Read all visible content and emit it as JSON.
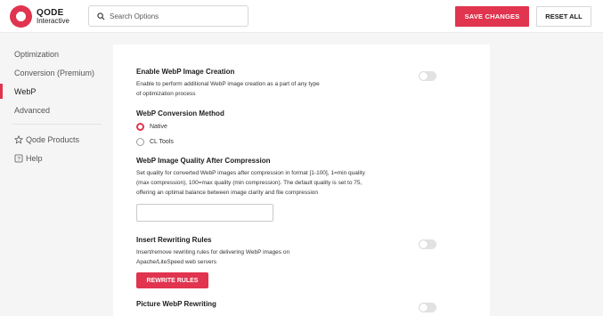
{
  "brand": {
    "name": "QODE",
    "sub": "Interactive"
  },
  "search": {
    "placeholder": "Search Options"
  },
  "header": {
    "save_label": "SAVE CHANGES",
    "reset_label": "RESET ALL"
  },
  "sidebar": {
    "items": [
      {
        "label": "Optimization",
        "active": false
      },
      {
        "label": "Conversion (Premium)",
        "active": false
      },
      {
        "label": "WebP",
        "active": true
      },
      {
        "label": "Advanced",
        "active": false
      }
    ],
    "aux": [
      {
        "label": "Qode Products",
        "icon": "star-icon"
      },
      {
        "label": "Help",
        "icon": "help-icon"
      }
    ]
  },
  "content": {
    "enable_webp": {
      "title": "Enable WebP Image Creation",
      "desc_line1": "Enable to perform additional WebP image creation as a part of any type",
      "desc_line2": "of optimization process",
      "enabled": false
    },
    "conversion_method": {
      "title": "WebP Conversion Method",
      "options": [
        "Native",
        "CL Tools"
      ],
      "selected": "Native"
    },
    "quality": {
      "title": "WebP Image Quality After Compression",
      "desc_line1": "Set quality for converted WebP images after compression in format [1-100], 1=min quality",
      "desc_line2": "(max compression), 100=max quality (min compression). The default quality is set to 75,",
      "desc_line3": "offering an optimal balance between image clarity and file compression",
      "value": ""
    },
    "rewriting_rules": {
      "title": "Insert Rewriting Rules",
      "desc_line1": "Insert/remove rewriting rules for delivering WebP images on",
      "desc_line2": "Apache/LiteSpeed web servers",
      "button_label": "REWRITE RULES",
      "enabled": false
    },
    "picture_rewriting": {
      "title": "Picture WebP Rewriting",
      "enabled": false
    }
  },
  "colors": {
    "accent": "#e0344f",
    "toggle_off": "#e2e2e2",
    "background": "#f5f5f6"
  }
}
